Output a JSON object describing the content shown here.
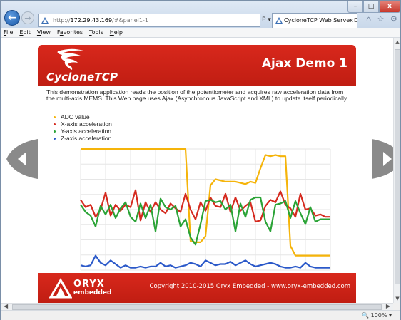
{
  "browser": {
    "url_host": "172.29.43.169",
    "url_path": "/#&panel1-1",
    "tab_title": "CycloneTCP Web Server D...",
    "tab_close": "×",
    "addr_tools": "P ▾ C",
    "window_min": "–",
    "window_max": "□",
    "window_close": "x",
    "menu": [
      {
        "label": "File",
        "accel": "F"
      },
      {
        "label": "Edit",
        "accel": "E"
      },
      {
        "label": "View",
        "accel": "V"
      },
      {
        "label": "Favorites",
        "accel": "a"
      },
      {
        "label": "Tools",
        "accel": "T"
      },
      {
        "label": "Help",
        "accel": "H"
      }
    ],
    "zoom": "100%",
    "toolbar_icons": [
      "home-icon",
      "star-icon",
      "gear-icon"
    ]
  },
  "page": {
    "logo_text": "CycloneTCP",
    "title": "Ajax Demo 1",
    "description": "This demonstration application reads the position of the potentiometer and acquires raw acceleration data from the multi-axis MEMS. This Web page uses Ajax (Asynchronous JavaScript and XML) to update itself periodically.",
    "footer_brand": "ORYX",
    "footer_sub": "embedded",
    "copyright": "Copyright 2010-2015 Oryx Embedded - www.oryx-embedded.com"
  },
  "colors": {
    "header_red": "#c8231a",
    "adc": "#f5b40a",
    "x": "#d52a1f",
    "y": "#2aa336",
    "z": "#2b59c9"
  },
  "chart_data": {
    "type": "line",
    "title": "",
    "xlabel": "",
    "ylabel": "",
    "grid": true,
    "legend_position": "top-left",
    "ylim": [
      0,
      100
    ],
    "x": [
      0,
      1,
      2,
      3,
      4,
      5,
      6,
      7,
      8,
      9,
      10,
      11,
      12,
      13,
      14,
      15,
      16,
      17,
      18,
      19,
      20,
      21,
      22,
      23,
      24,
      25,
      26,
      27,
      28,
      29,
      30,
      31,
      32,
      33,
      34,
      35,
      36,
      37,
      38,
      39,
      40,
      41,
      42,
      43,
      44,
      45,
      46,
      47,
      48,
      49,
      50
    ],
    "series": [
      {
        "name": "ADC value",
        "color": "#f5b40a",
        "values": [
          100,
          100,
          100,
          100,
          100,
          100,
          100,
          100,
          100,
          100,
          100,
          100,
          100,
          100,
          100,
          100,
          100,
          100,
          100,
          100,
          100,
          100,
          24,
          23,
          23,
          28,
          70,
          75,
          74,
          73,
          73,
          73,
          72,
          71,
          73,
          72,
          84,
          95,
          94,
          95,
          94,
          94,
          20,
          12,
          12,
          12,
          12,
          12,
          12,
          12,
          12
        ]
      },
      {
        "name": "X-axis acceleration",
        "color": "#d52a1f",
        "values": [
          58,
          52,
          54,
          44,
          50,
          64,
          45,
          54,
          49,
          54,
          52,
          66,
          41,
          56,
          48,
          56,
          50,
          47,
          55,
          51,
          48,
          63,
          50,
          42,
          56,
          49,
          60,
          53,
          52,
          63,
          48,
          60,
          49,
          53,
          56,
          40,
          41,
          53,
          58,
          56,
          65,
          54,
          51,
          44,
          63,
          50,
          51,
          45,
          46,
          44,
          44
        ]
      },
      {
        "name": "Y-axis acceleration",
        "color": "#2aa336",
        "values": [
          54,
          48,
          45,
          36,
          53,
          46,
          54,
          43,
          51,
          56,
          44,
          40,
          55,
          43,
          54,
          32,
          59,
          52,
          50,
          53,
          36,
          42,
          27,
          21,
          38,
          57,
          58,
          56,
          57,
          50,
          54,
          32,
          55,
          44,
          58,
          60,
          60,
          40,
          32,
          54,
          55,
          57,
          43,
          57,
          47,
          38,
          52,
          40,
          42,
          42,
          42
        ]
      },
      {
        "name": "Z-axis acceleration",
        "color": "#2b59c9",
        "values": [
          4,
          3,
          4,
          12,
          6,
          4,
          8,
          5,
          2,
          4,
          2,
          2,
          3,
          2,
          3,
          3,
          6,
          3,
          4,
          2,
          3,
          4,
          6,
          5,
          3,
          8,
          6,
          4,
          5,
          5,
          7,
          4,
          6,
          8,
          5,
          3,
          4,
          5,
          6,
          5,
          3,
          2,
          2,
          3,
          2,
          6,
          3,
          2,
          2,
          2,
          2
        ]
      }
    ]
  }
}
